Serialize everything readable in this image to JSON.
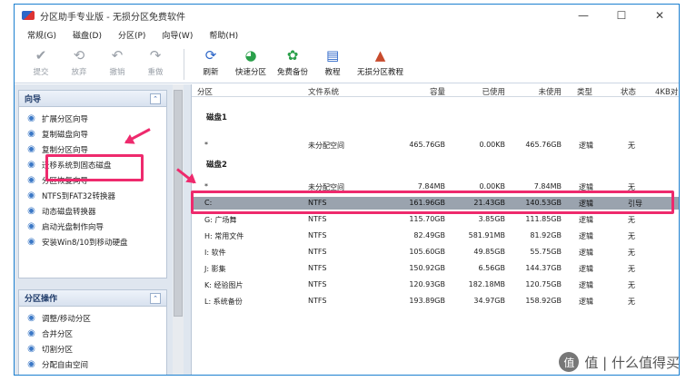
{
  "window": {
    "title": "分区助手专业版 - 无损分区免费软件"
  },
  "menu": [
    "常规(G)",
    "磁盘(D)",
    "分区(P)",
    "向导(W)",
    "帮助(H)"
  ],
  "toolbar": [
    {
      "label": "提交",
      "icon": "check-icon",
      "glyph": "✔",
      "enabled": false
    },
    {
      "label": "放弃",
      "icon": "discard-icon",
      "glyph": "⟲",
      "enabled": false
    },
    {
      "label": "撤销",
      "icon": "undo-icon",
      "glyph": "↶",
      "enabled": false
    },
    {
      "label": "重做",
      "icon": "redo-icon",
      "glyph": "↷",
      "enabled": false
    },
    {
      "label": "刷新",
      "icon": "refresh-icon",
      "glyph": "⟳",
      "enabled": true
    },
    {
      "label": "快速分区",
      "icon": "quick-partition-icon",
      "glyph": "◕",
      "enabled": true
    },
    {
      "label": "免费备份",
      "icon": "backup-icon",
      "glyph": "✿",
      "enabled": true
    },
    {
      "label": "教程",
      "icon": "tutorial-icon",
      "glyph": "▤",
      "enabled": true
    },
    {
      "label": "无损分区教程",
      "icon": "lossless-tutorial-icon",
      "glyph": "▲",
      "enabled": true
    }
  ],
  "wizard_panel": {
    "title": "向导",
    "items": [
      {
        "label": "扩展分区向导",
        "icon": "extend-partition-icon"
      },
      {
        "label": "复制磁盘向导",
        "icon": "copy-disk-icon"
      },
      {
        "label": "复制分区向导",
        "icon": "copy-partition-icon"
      },
      {
        "label": "迁移系统到固态磁盘",
        "icon": "migrate-ssd-icon"
      },
      {
        "label": "分区恢复向导",
        "icon": "partition-recovery-icon"
      },
      {
        "label": "NTFS到FAT32转换器",
        "icon": "ntfs-fat32-icon"
      },
      {
        "label": "动态磁盘转换器",
        "icon": "dynamic-disk-icon"
      },
      {
        "label": "启动光盘制作向导",
        "icon": "boot-disc-icon"
      },
      {
        "label": "安装Win8/10到移动硬盘",
        "icon": "install-win-icon"
      }
    ]
  },
  "ops_panel": {
    "title": "分区操作",
    "items": [
      {
        "label": "调整/移动分区",
        "icon": "resize-move-icon"
      },
      {
        "label": "合并分区",
        "icon": "merge-icon"
      },
      {
        "label": "切割分区",
        "icon": "split-icon"
      },
      {
        "label": "分配自由空间",
        "icon": "allocate-space-icon"
      }
    ]
  },
  "table": {
    "columns": [
      "分区",
      "文件系统",
      "容量",
      "已使用",
      "未使用",
      "类型",
      "状态",
      "4KB对"
    ],
    "disks": [
      {
        "label": "磁盘1",
        "rows": [
          [
            "*",
            "未分配空间",
            "465.76GB",
            "0.00KB",
            "465.76GB",
            "逻辑",
            "无"
          ]
        ]
      },
      {
        "label": "磁盘2",
        "rows": [
          [
            "*",
            "未分配空间",
            "7.84MB",
            "0.00KB",
            "7.84MB",
            "逻辑",
            "无"
          ],
          [
            "C:",
            "NTFS",
            "161.96GB",
            "21.43GB",
            "140.53GB",
            "逻辑",
            "引导"
          ],
          [
            "G: 广场舞",
            "NTFS",
            "115.70GB",
            "3.85GB",
            "111.85GB",
            "逻辑",
            "无"
          ],
          [
            "H: 常用文件",
            "NTFS",
            "82.49GB",
            "581.91MB",
            "81.92GB",
            "逻辑",
            "无"
          ],
          [
            "I: 软件",
            "NTFS",
            "105.60GB",
            "49.85GB",
            "55.75GB",
            "逻辑",
            "无"
          ],
          [
            "J: 影集",
            "NTFS",
            "150.92GB",
            "6.56GB",
            "144.37GB",
            "逻辑",
            "无"
          ],
          [
            "K: 经验图片",
            "NTFS",
            "120.93GB",
            "182.18MB",
            "120.75GB",
            "逻辑",
            "无"
          ],
          [
            "L: 系统备份",
            "NTFS",
            "193.89GB",
            "34.97GB",
            "158.92GB",
            "逻辑",
            "无"
          ]
        ]
      }
    ],
    "selected_row": "C:"
  },
  "watermark": {
    "text": "值 | 什么值得买",
    "badge": "值"
  },
  "colors": {
    "highlight": "#ee2a6d",
    "window_border": "#1b7fd0",
    "selected_row": "#9aa3ae"
  }
}
